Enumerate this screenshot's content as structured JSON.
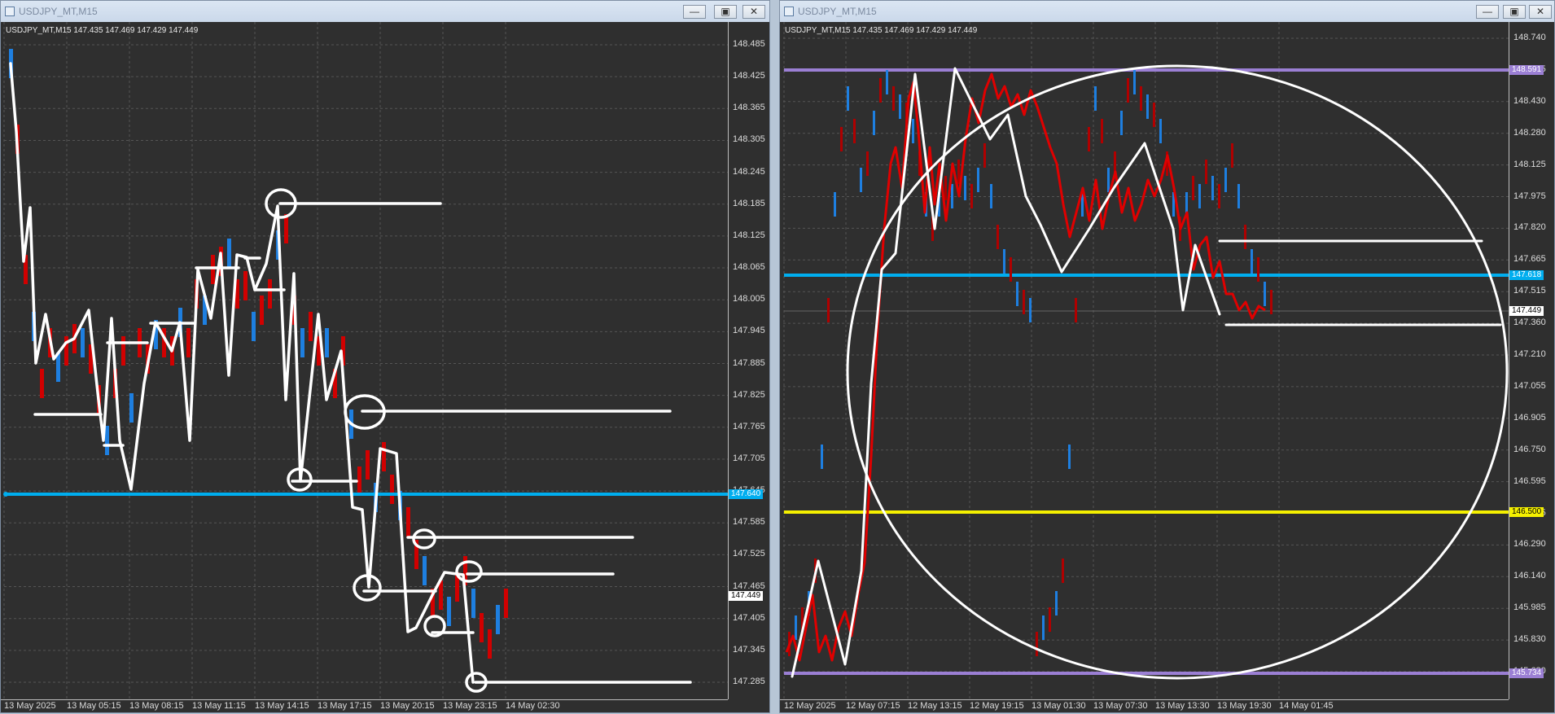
{
  "left": {
    "title": "USDJPY_MT,M15",
    "symbol_line": "USDJPY_MT,M15  147.435 147.469 147.429 147.449",
    "yticks": [
      "148.485",
      "148.425",
      "148.365",
      "148.305",
      "148.245",
      "148.185",
      "148.125",
      "148.065",
      "148.005",
      "147.945",
      "147.885",
      "147.825",
      "147.765",
      "147.705",
      "147.645",
      "147.585",
      "147.525",
      "147.465",
      "147.405",
      "147.345",
      "147.285"
    ],
    "xticks": [
      "13 May 2025",
      "13 May 05:15",
      "13 May 08:15",
      "13 May 11:15",
      "13 May 14:15",
      "13 May 17:15",
      "13 May 20:15",
      "13 May 23:15",
      "14 May 02:30"
    ],
    "price_label": "147.449",
    "level_label": "147.640",
    "colors": {
      "level": "#00aeef",
      "bull": "#1e7fe0",
      "bear": "#d10000"
    }
  },
  "right": {
    "title": "USDJPY_MT,M15",
    "symbol_line": "USDJPY_MT,M15  147.435 147.469 147.429 147.449",
    "yticks": [
      "148.740",
      "148.585",
      "148.430",
      "148.280",
      "148.125",
      "147.975",
      "147.820",
      "147.665",
      "147.515",
      "147.360",
      "147.210",
      "147.055",
      "146.905",
      "146.750",
      "146.595",
      "146.445",
      "146.290",
      "146.140",
      "145.985",
      "145.830",
      "145.680"
    ],
    "xticks": [
      "12 May 2025",
      "12 May 07:15",
      "12 May 13:15",
      "12 May 19:15",
      "13 May 01:30",
      "13 May 07:30",
      "13 May 13:30",
      "13 May 19:30",
      "14 May 01:45"
    ],
    "price_label": "147.449",
    "labels": {
      "purple_top": "148.591",
      "cyan": "147.618",
      "yellow": "146.500",
      "purple_bottom": "145.734"
    },
    "colors": {
      "purple": "#9b7fd4",
      "cyan": "#00aeef",
      "yellow": "#f5f000",
      "bear": "#d10000"
    }
  }
}
